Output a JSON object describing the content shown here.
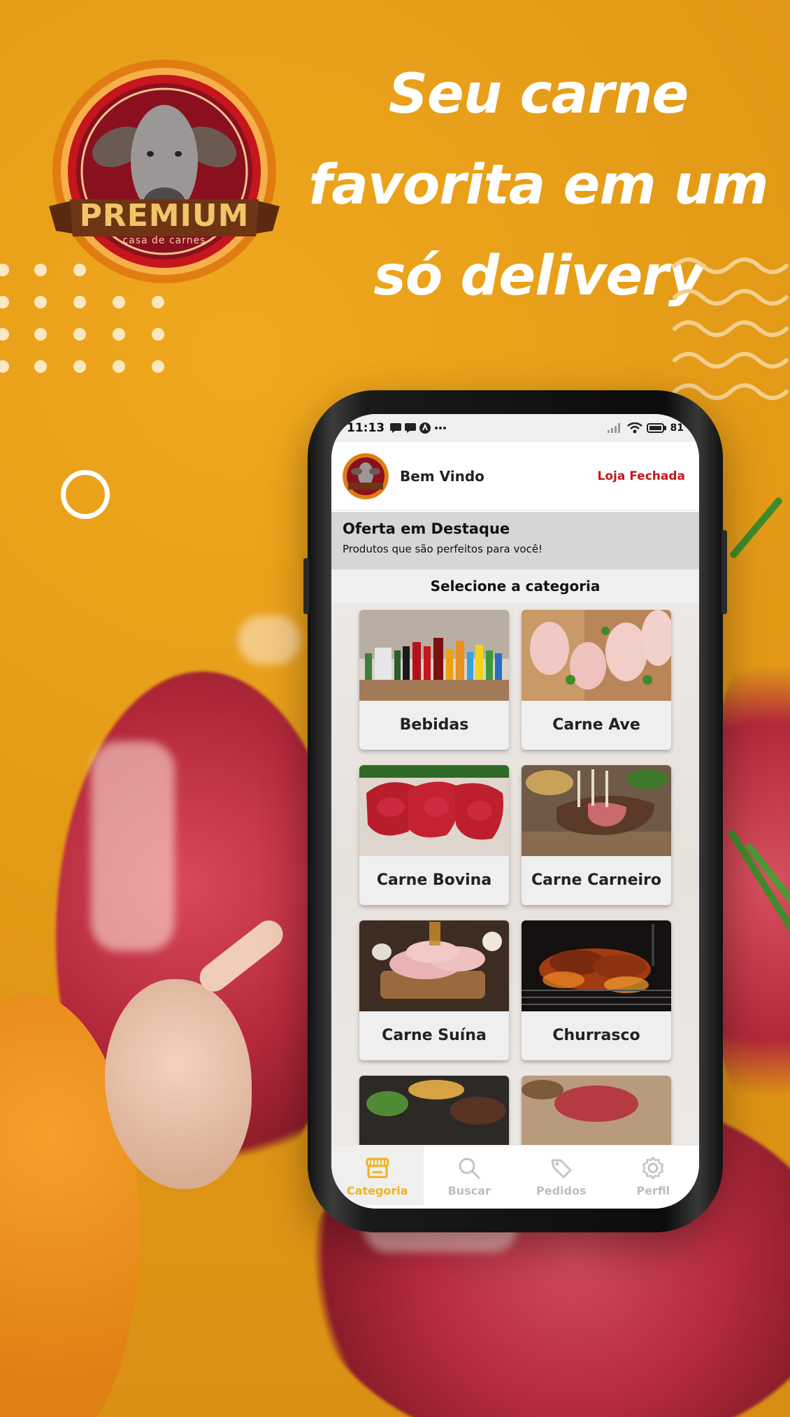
{
  "brand": {
    "name": "PREMIUM",
    "tagline": "casa de carnes"
  },
  "headline": {
    "line1": "Seu carne",
    "line2": "favorita em um",
    "line3": "só delivery"
  },
  "colors": {
    "background": "#e39a17",
    "accent_yellow": "#f2b11c",
    "closed_red": "#c4161c",
    "logo_maroon": "#8a1020"
  },
  "status_bar": {
    "time": "11:13",
    "battery": "81"
  },
  "header": {
    "welcome": "Bem Vindo",
    "store_status": "Loja Fechada"
  },
  "featured": {
    "title": "Oferta em Destaque",
    "subtitle": "Produtos que são perfeitos para você!"
  },
  "categories": {
    "heading": "Selecione a categoria",
    "items": [
      {
        "label": "Bebidas"
      },
      {
        "label": "Carne Ave"
      },
      {
        "label": "Carne Bovina"
      },
      {
        "label": "Carne Carneiro"
      },
      {
        "label": "Carne Suína"
      },
      {
        "label": "Churrasco"
      }
    ]
  },
  "tabs": [
    {
      "label": "Categoria",
      "icon": "store-icon",
      "active": true
    },
    {
      "label": "Buscar",
      "icon": "search-icon",
      "active": false
    },
    {
      "label": "Pedidos",
      "icon": "tag-icon",
      "active": false
    },
    {
      "label": "Perfil",
      "icon": "gear-icon",
      "active": false
    }
  ]
}
